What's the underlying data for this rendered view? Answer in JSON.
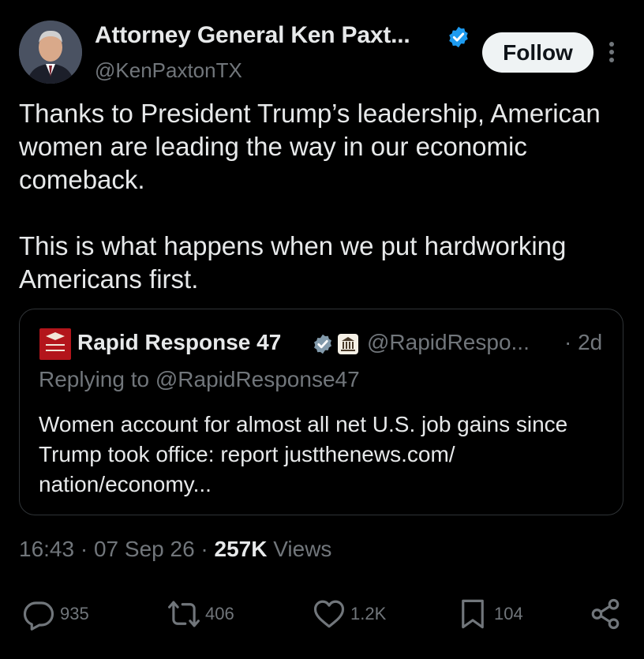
{
  "author": {
    "name": "Attorney General Ken Paxt...",
    "handle": "@KenPaxtonTX",
    "verified_color": "#1d9bf0",
    "avatar_icon": "portrait-photo"
  },
  "follow_label": "Follow",
  "tweet": {
    "paragraph1": "Thanks to President Trump’s leadership, American women are leading the way in our economic comeback.",
    "paragraph2": "This is what happens when we put hardworking Americans first."
  },
  "quote": {
    "name": "Rapid Response 47",
    "handle": "@RapidRespo...",
    "time": "· 2d",
    "replying_to": "Replying to @RapidResponse47",
    "text": "Women account for almost all net U.S. job gains since Trump took office: report justthenews.com/ nation/economy...",
    "logo_icon": "rapid-response-logo",
    "affiliation_icon": "white-house-badge"
  },
  "meta": {
    "time": "16:43",
    "separator": "·",
    "date": "07 Sep 26",
    "views_count": "257K",
    "views_label": "Views"
  },
  "actions": {
    "replies": "935",
    "reposts": "406",
    "likes": "1.2K",
    "bookmarks": "104"
  }
}
